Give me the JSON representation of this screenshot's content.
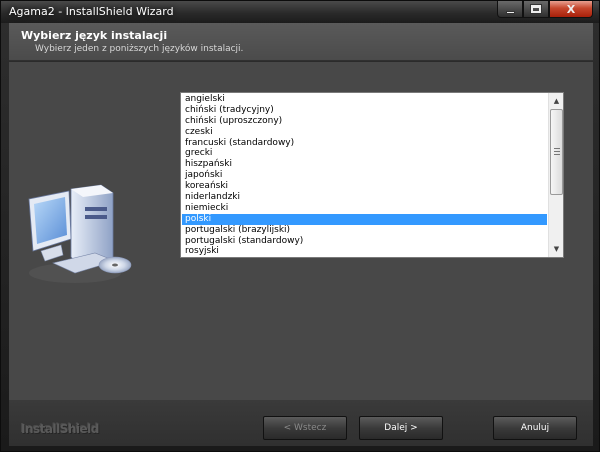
{
  "window": {
    "title": "Agama2 - InstallShield Wizard",
    "close_glyph": "X"
  },
  "header": {
    "title": "Wybierz język instalacji",
    "subtitle": "Wybierz jeden z poniższych języków instalacji."
  },
  "language_list": {
    "items": [
      "angielski",
      "chiński (tradycyjny)",
      "chiński (uproszczony)",
      "czeski",
      "francuski (standardowy)",
      "grecki",
      "hiszpański",
      "japoński",
      "koreański",
      "niderlandzki",
      "niemiecki",
      "polski",
      "portugalski (brazylijski)",
      "portugalski (standardowy)",
      "rosyjski"
    ],
    "selected": "polski"
  },
  "footer": {
    "brand": "InstallShield",
    "back_label": "< Wstecz",
    "next_label": "Dalej >",
    "cancel_label": "Anuluj"
  },
  "colors": {
    "selection": "#3399ff",
    "close_button": "#c6472d"
  }
}
